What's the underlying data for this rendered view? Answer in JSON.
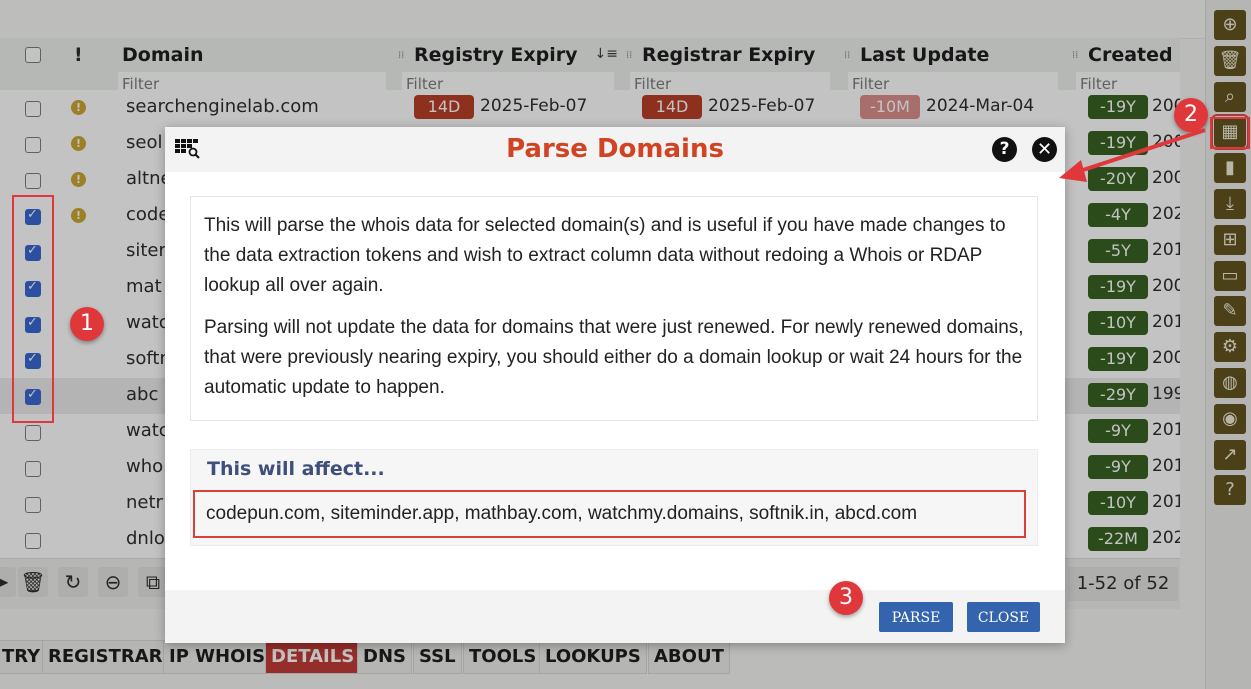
{
  "grid": {
    "columns": [
      {
        "title": "Domain",
        "filter_placeholder": "Filter"
      },
      {
        "title": "Registry Expiry",
        "filter_placeholder": "Filter",
        "sorted": true
      },
      {
        "title": "Registrar Expiry",
        "filter_placeholder": "Filter"
      },
      {
        "title": "Last Update",
        "filter_placeholder": "Filter"
      },
      {
        "title": "Created C",
        "filter_placeholder": "Filter"
      }
    ],
    "warn_header": "!",
    "rows": [
      {
        "checked": false,
        "warn": true,
        "domain": "searchenginelab.com",
        "reg_badge": "14D",
        "reg_date": "2025-Feb-07",
        "rar_badge": "14D",
        "rar_date": "2025-Feb-07",
        "upd_badge": "-10M",
        "upd_date": "2024-Mar-04",
        "created_badge": "-19Y",
        "created_date": "200"
      },
      {
        "checked": false,
        "warn": true,
        "domain": "seol",
        "created_badge": "-19Y",
        "created_date": "200"
      },
      {
        "checked": false,
        "warn": true,
        "domain": "altne",
        "created_badge": "-20Y",
        "created_date": "200"
      },
      {
        "checked": true,
        "warn": true,
        "domain": "code",
        "created_badge": "-4Y",
        "created_date": "202"
      },
      {
        "checked": true,
        "warn": false,
        "domain": "siter",
        "created_badge": "-5Y",
        "created_date": "201"
      },
      {
        "checked": true,
        "warn": false,
        "domain": "mat",
        "created_badge": "-19Y",
        "created_date": "200"
      },
      {
        "checked": true,
        "warn": false,
        "domain": "watc",
        "created_badge": "-10Y",
        "created_date": "201"
      },
      {
        "checked": true,
        "warn": false,
        "domain": "softn",
        "created_badge": "-19Y",
        "created_date": "200"
      },
      {
        "checked": true,
        "warn": false,
        "domain": "abc",
        "created_badge": "-29Y",
        "created_date": "199",
        "highlight": true
      },
      {
        "checked": false,
        "warn": false,
        "domain": "watc",
        "created_badge": "-9Y",
        "created_date": "201"
      },
      {
        "checked": false,
        "warn": false,
        "domain": "who",
        "created_badge": "-9Y",
        "created_date": "201"
      },
      {
        "checked": false,
        "warn": false,
        "domain": "netr",
        "created_badge": "-10Y",
        "created_date": "201"
      },
      {
        "checked": false,
        "warn": false,
        "domain": "dnlo",
        "created_badge": "-22M",
        "created_date": "202"
      }
    ],
    "pager": "1-52 of 52"
  },
  "bottom_tools": [
    "delete-selected-icon",
    "refresh-icon",
    "remove-icon",
    "copy-icon"
  ],
  "tabs": [
    {
      "label": "TRY",
      "active": false
    },
    {
      "label": "REGISTRAR",
      "active": false
    },
    {
      "label": "IP WHOIS",
      "active": false
    },
    {
      "label": "DETAILS",
      "active": true
    },
    {
      "label": "DNS",
      "active": false
    },
    {
      "label": "SSL",
      "active": false
    },
    {
      "label": "TOOLS",
      "active": false
    },
    {
      "label": "LOOKUPS",
      "active": false
    },
    {
      "label": "ABOUT",
      "active": false
    }
  ],
  "side_tools": [
    {
      "name": "add-icon",
      "glyph": "⊕"
    },
    {
      "name": "trash-icon",
      "glyph": "🗑"
    },
    {
      "name": "search-icon",
      "glyph": "⌕"
    },
    {
      "name": "parse-domains-icon",
      "glyph": "▦",
      "marked": true
    },
    {
      "name": "bookmark-icon",
      "glyph": "▮"
    },
    {
      "name": "download-icon",
      "glyph": "⤓"
    },
    {
      "name": "add-column-icon",
      "glyph": "⊞"
    },
    {
      "name": "folder-check-icon",
      "glyph": "▭"
    },
    {
      "name": "edit-icon",
      "glyph": "✎"
    },
    {
      "name": "column-settings-icon",
      "glyph": "⚙"
    },
    {
      "name": "globe-icon",
      "glyph": "◍"
    },
    {
      "name": "palette-icon",
      "glyph": "◉"
    },
    {
      "name": "external-link-icon",
      "glyph": "↗"
    },
    {
      "name": "help-icon",
      "glyph": "?"
    }
  ],
  "modal": {
    "title": "Parse Domains",
    "help_glyph": "?",
    "close_glyph": "✕",
    "paragraphs": [
      "This will parse the whois data for selected domain(s) and is useful if you have made changes to the data extraction tokens and wish to extract column data without redoing a Whois or RDAP lookup all over again.",
      "Parsing will not update the data for domains that were just renewed. For newly renewed domains, that were previously nearing expiry, you should either do a domain lookup or wait 24 hours for the automatic update to happen."
    ],
    "affect_title": "This will affect...",
    "affected_domains": "codepun.com, siteminder.app, mathbay.com, watchmy.domains, softnik.in, abcd.com",
    "parse_label": "PARSE",
    "close_label": "CLOSE"
  },
  "callouts": [
    "1",
    "2",
    "3"
  ],
  "colors": {
    "accent_title": "#d04424",
    "button": "#3464ad",
    "active_tab": "#c0302b",
    "tool_bg": "#5a4a14",
    "callout": "#e0383a"
  }
}
